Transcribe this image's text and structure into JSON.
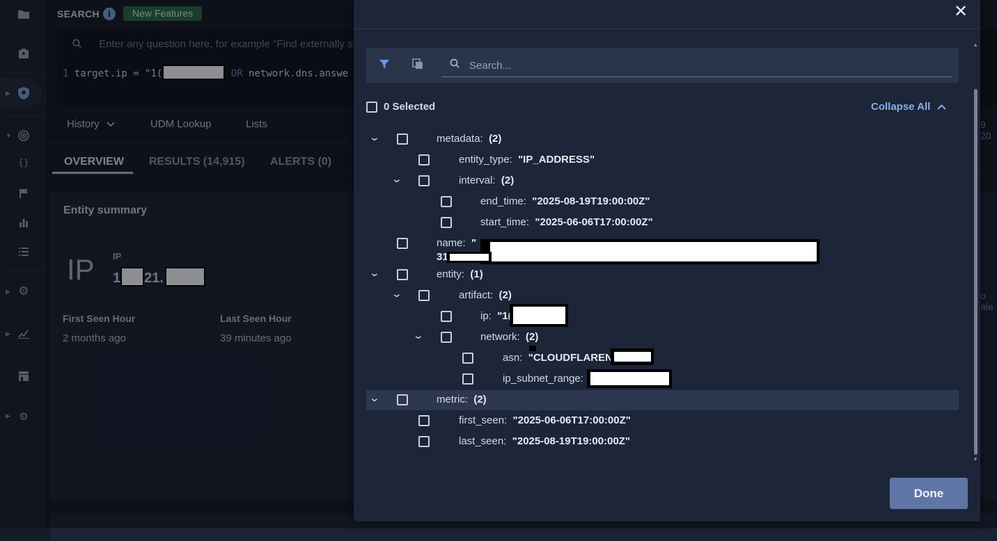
{
  "search": {
    "label": "SEARCH",
    "badge": "New Features",
    "placeholder": "Enter any question here, for example \"Find externally sh",
    "line_number": "1",
    "query_prefix": "target.ip = \"1(",
    "query_op": "OR",
    "query_suffix": "network.dns.answe"
  },
  "toolbar": {
    "history": "History",
    "udm_lookup": "UDM Lookup",
    "lists": "Lists"
  },
  "tabs": {
    "overview": "OVERVIEW",
    "results": "RESULTS (14,915)",
    "alerts": "ALERTS (0)"
  },
  "entity_summary": {
    "title": "Entity summary",
    "ip_abbrev": "IP",
    "ip_label": "IP",
    "ip_part1": "1",
    "ip_part2": "21.",
    "first_seen_label": "First Seen Hour",
    "first_seen_value": "2 months ago",
    "last_seen_label": "Last Seen Hour",
    "last_seen_value": "39 minutes ago"
  },
  "right_partial": {
    "date": "9 20",
    "alerts": "o ale"
  },
  "modal": {
    "close_label": "✕",
    "search_placeholder": "Search...",
    "selected_label": "0 Selected",
    "collapse_all": "Collapse All",
    "done": "Done",
    "tree": {
      "metadata": {
        "key": "metadata:",
        "val": "(2)"
      },
      "entity_type": {
        "key": "entity_type:",
        "val": "\"IP_ADDRESS\""
      },
      "interval": {
        "key": "interval:",
        "val": "(2)"
      },
      "end_time": {
        "key": "end_time:",
        "val": "\"2025-08-19T19:00:00Z\""
      },
      "start_time": {
        "key": "start_time:",
        "val": "\"2025-06-06T17:00:00Z\""
      },
      "name": {
        "key": "name:",
        "val": "\"",
        "val_line2": "31"
      },
      "entity": {
        "key": "entity:",
        "val": "(1)"
      },
      "artifact": {
        "key": "artifact:",
        "val": "(2)"
      },
      "ip": {
        "key": "ip:",
        "val": "\"1("
      },
      "network": {
        "key": "network:",
        "val": "(2)"
      },
      "asn": {
        "key": "asn:",
        "val": "\"CLOUDFLARENET"
      },
      "ip_subnet_range": {
        "key": "ip_subnet_range:",
        "val": ""
      },
      "metric": {
        "key": "metric:",
        "val": "(2)"
      },
      "first_seen": {
        "key": "first_seen:",
        "val": "\"2025-06-06T17:00:00Z\""
      },
      "last_seen": {
        "key": "last_seen:",
        "val": "\"2025-08-19T19:00:00Z\""
      }
    }
  }
}
